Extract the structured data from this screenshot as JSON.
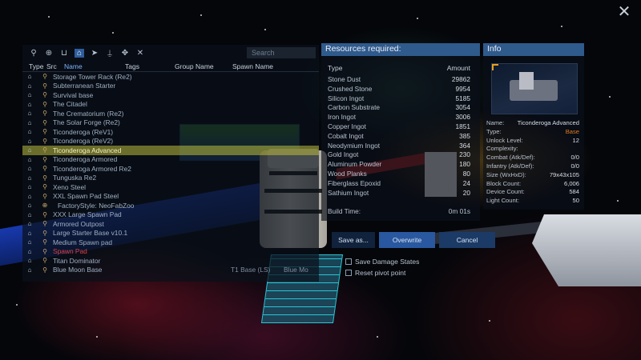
{
  "list": {
    "search_placeholder": "Search",
    "filter_icons": [
      "pin-icon",
      "magnify-globe-icon",
      "bag-icon",
      "home-icon",
      "ship-icon",
      "lander-icon",
      "drone-icon",
      "cross-icon"
    ],
    "columns": {
      "type": "Type",
      "src": "Src",
      "name": "Name",
      "tags": "Tags",
      "group": "Group Name",
      "spawn": "Spawn Name"
    },
    "rows": [
      {
        "name": "Storage Tower Rack (Re2)",
        "group": "",
        "spawn": ""
      },
      {
        "name": "Subterranean Starter",
        "group": "",
        "spawn": ""
      },
      {
        "name": "Survival base",
        "group": "",
        "spawn": ""
      },
      {
        "name": "The Citadel",
        "group": "",
        "spawn": ""
      },
      {
        "name": "The Crematorium (Re2)",
        "group": "",
        "spawn": ""
      },
      {
        "name": "The Solar Forge (Re2)",
        "group": "",
        "spawn": ""
      },
      {
        "name": "Ticonderoga (ReV1)",
        "group": "",
        "spawn": ""
      },
      {
        "name": "Ticonderoga (ReV2)",
        "group": "",
        "spawn": ""
      },
      {
        "name": "Ticonderoga Advanced",
        "group": "",
        "spawn": "",
        "selected": true
      },
      {
        "name": "Ticonderoga Armored",
        "group": "",
        "spawn": ""
      },
      {
        "name": "Ticonderoga Armored Re2",
        "group": "",
        "spawn": ""
      },
      {
        "name": "Tunguska Re2",
        "group": "",
        "spawn": ""
      },
      {
        "name": "Xeno Steel",
        "group": "",
        "spawn": ""
      },
      {
        "name": "XXL Spawn Pad Steel",
        "group": "",
        "spawn": ""
      },
      {
        "name": "XXX Large Spawn Pad",
        "group": "",
        "spawn": ""
      },
      {
        "name": "Armored Outpost",
        "group": "",
        "spawn": ""
      },
      {
        "name": "Large Starter Base v10.1",
        "group": "",
        "spawn": ""
      },
      {
        "name": "Medium Spawn pad",
        "group": "",
        "spawn": ""
      },
      {
        "name": "Spawn Pad",
        "group": "",
        "spawn": "",
        "red": true
      },
      {
        "name": "Titan Dominator",
        "group": "",
        "spawn": ""
      },
      {
        "name": "Blue Moon Base",
        "group": "T1 Base (LS)",
        "spawn": "Blue Mo"
      }
    ],
    "extra_row": "FactoryStyle: NeoFabZoo"
  },
  "resources": {
    "title": "Resources required:",
    "col_type": "Type",
    "col_amount": "Amount",
    "items": [
      {
        "type": "Stone Dust",
        "amount": "29862"
      },
      {
        "type": "Crushed Stone",
        "amount": "9954"
      },
      {
        "type": "Silicon Ingot",
        "amount": "5185"
      },
      {
        "type": "Carbon Substrate",
        "amount": "3054"
      },
      {
        "type": "Iron Ingot",
        "amount": "3006"
      },
      {
        "type": "Copper Ingot",
        "amount": "1851"
      },
      {
        "type": "Cobalt Ingot",
        "amount": "385"
      },
      {
        "type": "Neodymium Ingot",
        "amount": "364"
      },
      {
        "type": "Gold Ingot",
        "amount": "230"
      },
      {
        "type": "Aluminum Powder",
        "amount": "180"
      },
      {
        "type": "Wood Planks",
        "amount": "80"
      },
      {
        "type": "Fiberglass Epoxid",
        "amount": "24"
      },
      {
        "type": "Sathium Ingot",
        "amount": "20"
      }
    ],
    "build_time_label": "Build Time:",
    "build_time_value": "0m 01s"
  },
  "info": {
    "title": "Info",
    "rows": [
      {
        "label": "Name:",
        "value": "Ticonderoga Advanced"
      },
      {
        "label": "Type:",
        "value": "Base",
        "accent": true
      },
      {
        "label": "Unlock Level:",
        "value": "12"
      },
      {
        "label": "Complexity:",
        "value": ""
      },
      {
        "label": "Combat (Atk/Def):",
        "value": "0/0"
      },
      {
        "label": "Infantry (Atk/Def):",
        "value": "0/0"
      },
      {
        "label": "Size (WxHxD):",
        "value": "79x43x105"
      },
      {
        "label": "Block Count:",
        "value": "6,006"
      },
      {
        "label": "Device Count:",
        "value": "584"
      },
      {
        "label": "Light Count:",
        "value": "50"
      }
    ]
  },
  "buttons": {
    "save": "Save as...",
    "overwrite": "Overwrite",
    "cancel": "Cancel"
  },
  "options": {
    "damage": "Save Damage States",
    "pivot": "Reset pivot point"
  },
  "colors": {
    "accent_blue": "#2f5a8c",
    "selected_row": "#bebe3c",
    "warning_red": "#e04040",
    "base_orange": "#e07a20"
  }
}
